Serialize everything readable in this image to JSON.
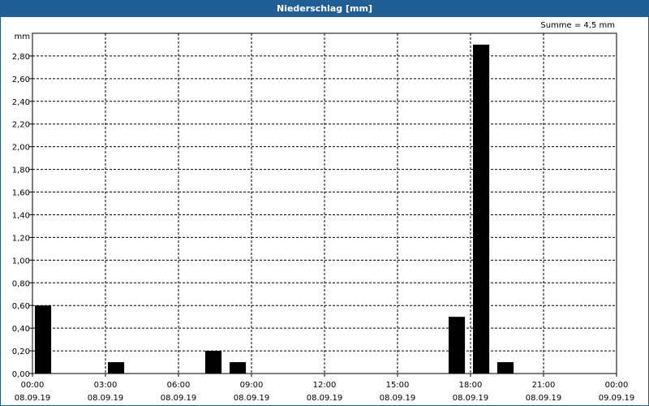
{
  "header": {
    "title": "Niederschlag [mm]",
    "title_bg": "#1f5f96"
  },
  "summary": "Summe = 4,5 mm",
  "chart_data": {
    "type": "bar",
    "title": "Niederschlag [mm]",
    "ylabel": "mm",
    "xlabel": "",
    "ylim": [
      0,
      3.0
    ],
    "y_tick_values": [
      0.0,
      0.2,
      0.4,
      0.6,
      0.8,
      1.0,
      1.2,
      1.4,
      1.6,
      1.8,
      2.0,
      2.2,
      2.4,
      2.6,
      2.8
    ],
    "y_tick_labels": [
      "0,00",
      "0,20",
      "0,40",
      "0,60",
      "0,80",
      "1,00",
      "1,20",
      "1,40",
      "1,60",
      "1,80",
      "2,00",
      "2,20",
      "2,40",
      "2,60",
      "2,80"
    ],
    "x_ticks": [
      {
        "time": "00:00",
        "date": "08.09.19"
      },
      {
        "time": "03:00",
        "date": "08.09.19"
      },
      {
        "time": "06:00",
        "date": "08.09.19"
      },
      {
        "time": "09:00",
        "date": "08.09.19"
      },
      {
        "time": "12:00",
        "date": "08.09.19"
      },
      {
        "time": "15:00",
        "date": "08.09.19"
      },
      {
        "time": "18:00",
        "date": "08.09.19"
      },
      {
        "time": "21:00",
        "date": "08.09.19"
      },
      {
        "time": "00:00",
        "date": "09.09.19"
      }
    ],
    "x_range_hours": [
      0,
      24
    ],
    "bar_width_hours": 0.67,
    "bars": [
      {
        "hour": 0,
        "value": 0.6
      },
      {
        "hour": 3,
        "value": 0.1
      },
      {
        "hour": 7,
        "value": 0.2
      },
      {
        "hour": 8,
        "value": 0.1
      },
      {
        "hour": 17,
        "value": 0.5
      },
      {
        "hour": 18,
        "value": 2.9
      },
      {
        "hour": 19,
        "value": 0.1
      }
    ],
    "grid": true,
    "grid_style": "dashed",
    "bar_color": "#000000"
  }
}
